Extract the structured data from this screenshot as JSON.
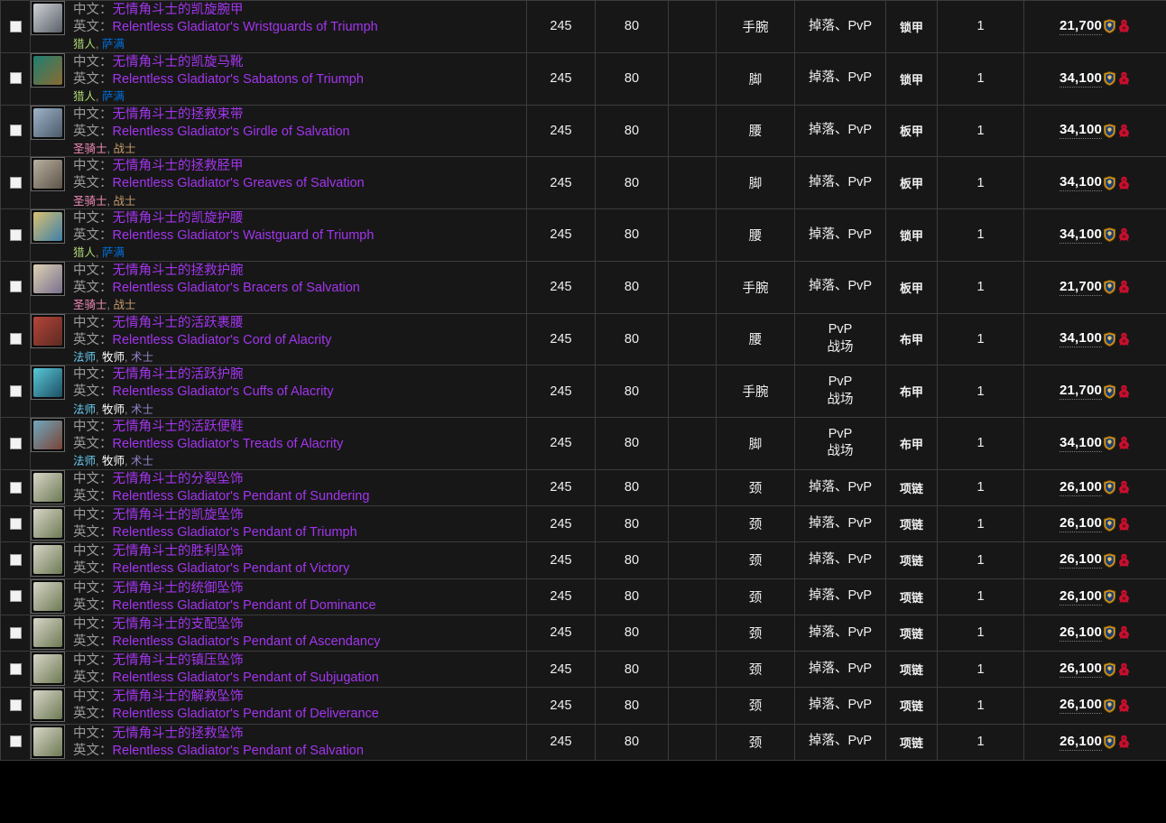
{
  "table": {
    "labels": {
      "chinese_prefix": "中文：",
      "english_prefix": "英文："
    },
    "class_colors": {
      "hunter": "#abd473",
      "shaman": "#0070de",
      "paladin": "#f58cba",
      "warrior": "#c79c6e",
      "mage": "#69ccf0",
      "priest": "#ffffff",
      "warlock": "#9482c9"
    },
    "quality_color": "#a335ee",
    "icons": {
      "honor": "honor-icon",
      "faction": "horde-icon",
      "checkbox": "checkbox-icon"
    },
    "rows": [
      {
        "cn": "无情角斗士的凯旋腕甲",
        "en": "Relentless Gladiator's Wristguards of Triumph",
        "classes": [
          {
            "name": "猎人",
            "color": "#abd473"
          },
          {
            "name": "萨满",
            "color": "#0070de"
          }
        ],
        "ilvl": "245",
        "level": "80",
        "blank": "",
        "slot": "手腕",
        "source": "掉落、PvP",
        "source2": "",
        "armor": "锁甲",
        "qty": "1",
        "cost": "21,700",
        "icon_from": "#cfd3d8",
        "icon_to": "#5a6068"
      },
      {
        "cn": "无情角斗士的凯旋马靴",
        "en": "Relentless Gladiator's Sabatons of Triumph",
        "classes": [
          {
            "name": "猎人",
            "color": "#abd473"
          },
          {
            "name": "萨满",
            "color": "#0070de"
          }
        ],
        "ilvl": "245",
        "level": "80",
        "blank": "",
        "slot": "脚",
        "source": "掉落、PvP",
        "source2": "",
        "armor": "锁甲",
        "qty": "1",
        "cost": "34,100",
        "icon_from": "#1f7f72",
        "icon_to": "#8a6a30"
      },
      {
        "cn": "无情角斗士的拯救束带",
        "en": "Relentless Gladiator's Girdle of Salvation",
        "classes": [
          {
            "name": "圣骑士",
            "color": "#f58cba"
          },
          {
            "name": "战士",
            "color": "#c79c6e"
          }
        ],
        "ilvl": "245",
        "level": "80",
        "blank": "",
        "slot": "腰",
        "source": "掉落、PvP",
        "source2": "",
        "armor": "板甲",
        "qty": "1",
        "cost": "34,100",
        "icon_from": "#9fb3c8",
        "icon_to": "#4a5a6a"
      },
      {
        "cn": "无情角斗士的拯救胫甲",
        "en": "Relentless Gladiator's Greaves of Salvation",
        "classes": [
          {
            "name": "圣骑士",
            "color": "#f58cba"
          },
          {
            "name": "战士",
            "color": "#c79c6e"
          }
        ],
        "ilvl": "245",
        "level": "80",
        "blank": "",
        "slot": "脚",
        "source": "掉落、PvP",
        "source2": "",
        "armor": "板甲",
        "qty": "1",
        "cost": "34,100",
        "icon_from": "#b9b0a0",
        "icon_to": "#5c5448"
      },
      {
        "cn": "无情角斗士的凯旋护腰",
        "en": "Relentless Gladiator's Waistguard of Triumph",
        "classes": [
          {
            "name": "猎人",
            "color": "#abd473"
          },
          {
            "name": "萨满",
            "color": "#0070de"
          }
        ],
        "ilvl": "245",
        "level": "80",
        "blank": "",
        "slot": "腰",
        "source": "掉落、PvP",
        "source2": "",
        "armor": "锁甲",
        "qty": "1",
        "cost": "34,100",
        "icon_from": "#d8c172",
        "icon_to": "#3f7fa8"
      },
      {
        "cn": "无情角斗士的拯救护腕",
        "en": "Relentless Gladiator's Bracers of Salvation",
        "classes": [
          {
            "name": "圣骑士",
            "color": "#f58cba"
          },
          {
            "name": "战士",
            "color": "#c79c6e"
          }
        ],
        "ilvl": "245",
        "level": "80",
        "blank": "",
        "slot": "手腕",
        "source": "掉落、PvP",
        "source2": "",
        "armor": "板甲",
        "qty": "1",
        "cost": "21,700",
        "icon_from": "#ddd3b4",
        "icon_to": "#7a6f8e"
      },
      {
        "cn": "无情角斗士的活跃裹腰",
        "en": "Relentless Gladiator's Cord of Alacrity",
        "classes": [
          {
            "name": "法师",
            "color": "#69ccf0"
          },
          {
            "name": "牧师",
            "color": "#ffffff"
          },
          {
            "name": "术士",
            "color": "#9482c9"
          }
        ],
        "ilvl": "245",
        "level": "80",
        "blank": "",
        "slot": "腰",
        "source": "PvP",
        "source2": "战场",
        "armor": "布甲",
        "qty": "1",
        "cost": "34,100",
        "icon_from": "#b4453a",
        "icon_to": "#5d2a22"
      },
      {
        "cn": "无情角斗士的活跃护腕",
        "en": "Relentless Gladiator's Cuffs of Alacrity",
        "classes": [
          {
            "name": "法师",
            "color": "#69ccf0"
          },
          {
            "name": "牧师",
            "color": "#ffffff"
          },
          {
            "name": "术士",
            "color": "#9482c9"
          }
        ],
        "ilvl": "245",
        "level": "80",
        "blank": "",
        "slot": "手腕",
        "source": "PvP",
        "source2": "战场",
        "armor": "布甲",
        "qty": "1",
        "cost": "21,700",
        "icon_from": "#58c9d8",
        "icon_to": "#1d4e63"
      },
      {
        "cn": "无情角斗士的活跃便鞋",
        "en": "Relentless Gladiator's Treads of Alacrity",
        "classes": [
          {
            "name": "法师",
            "color": "#69ccf0"
          },
          {
            "name": "牧师",
            "color": "#ffffff"
          },
          {
            "name": "术士",
            "color": "#9482c9"
          }
        ],
        "ilvl": "245",
        "level": "80",
        "blank": "",
        "slot": "脚",
        "source": "PvP",
        "source2": "战场",
        "armor": "布甲",
        "qty": "1",
        "cost": "34,100",
        "icon_from": "#6fa8c0",
        "icon_to": "#7a4436"
      },
      {
        "cn": "无情角斗士的分裂坠饰",
        "en": "Relentless Gladiator's Pendant of Sundering",
        "classes": [],
        "ilvl": "245",
        "level": "80",
        "blank": "",
        "slot": "颈",
        "source": "掉落、PvP",
        "source2": "",
        "armor": "项链",
        "qty": "1",
        "cost": "26,100",
        "icon_from": "#d9d6c8",
        "icon_to": "#6d7a55"
      },
      {
        "cn": "无情角斗士的凯旋坠饰",
        "en": "Relentless Gladiator's Pendant of Triumph",
        "classes": [],
        "ilvl": "245",
        "level": "80",
        "blank": "",
        "slot": "颈",
        "source": "掉落、PvP",
        "source2": "",
        "armor": "项链",
        "qty": "1",
        "cost": "26,100",
        "icon_from": "#d9d6c8",
        "icon_to": "#6d7a55"
      },
      {
        "cn": "无情角斗士的胜利坠饰",
        "en": "Relentless Gladiator's Pendant of Victory",
        "classes": [],
        "ilvl": "245",
        "level": "80",
        "blank": "",
        "slot": "颈",
        "source": "掉落、PvP",
        "source2": "",
        "armor": "项链",
        "qty": "1",
        "cost": "26,100",
        "icon_from": "#d9d6c8",
        "icon_to": "#6d7a55"
      },
      {
        "cn": "无情角斗士的统御坠饰",
        "en": "Relentless Gladiator's Pendant of Dominance",
        "classes": [],
        "ilvl": "245",
        "level": "80",
        "blank": "",
        "slot": "颈",
        "source": "掉落、PvP",
        "source2": "",
        "armor": "项链",
        "qty": "1",
        "cost": "26,100",
        "icon_from": "#d9d6c8",
        "icon_to": "#6d7a55"
      },
      {
        "cn": "无情角斗士的支配坠饰",
        "en": "Relentless Gladiator's Pendant of Ascendancy",
        "classes": [],
        "ilvl": "245",
        "level": "80",
        "blank": "",
        "slot": "颈",
        "source": "掉落、PvP",
        "source2": "",
        "armor": "项链",
        "qty": "1",
        "cost": "26,100",
        "icon_from": "#d9d6c8",
        "icon_to": "#6d7a55"
      },
      {
        "cn": "无情角斗士的镇压坠饰",
        "en": "Relentless Gladiator's Pendant of Subjugation",
        "classes": [],
        "ilvl": "245",
        "level": "80",
        "blank": "",
        "slot": "颈",
        "source": "掉落、PvP",
        "source2": "",
        "armor": "项链",
        "qty": "1",
        "cost": "26,100",
        "icon_from": "#d9d6c8",
        "icon_to": "#6d7a55"
      },
      {
        "cn": "无情角斗士的解救坠饰",
        "en": "Relentless Gladiator's Pendant of Deliverance",
        "classes": [],
        "ilvl": "245",
        "level": "80",
        "blank": "",
        "slot": "颈",
        "source": "掉落、PvP",
        "source2": "",
        "armor": "项链",
        "qty": "1",
        "cost": "26,100",
        "icon_from": "#d9d6c8",
        "icon_to": "#6d7a55"
      },
      {
        "cn": "无情角斗士的拯救坠饰",
        "en": "Relentless Gladiator's Pendant of Salvation",
        "classes": [],
        "ilvl": "245",
        "level": "80",
        "blank": "",
        "slot": "颈",
        "source": "掉落、PvP",
        "source2": "",
        "armor": "项链",
        "qty": "1",
        "cost": "26,100",
        "icon_from": "#d9d6c8",
        "icon_to": "#6d7a55"
      }
    ]
  }
}
